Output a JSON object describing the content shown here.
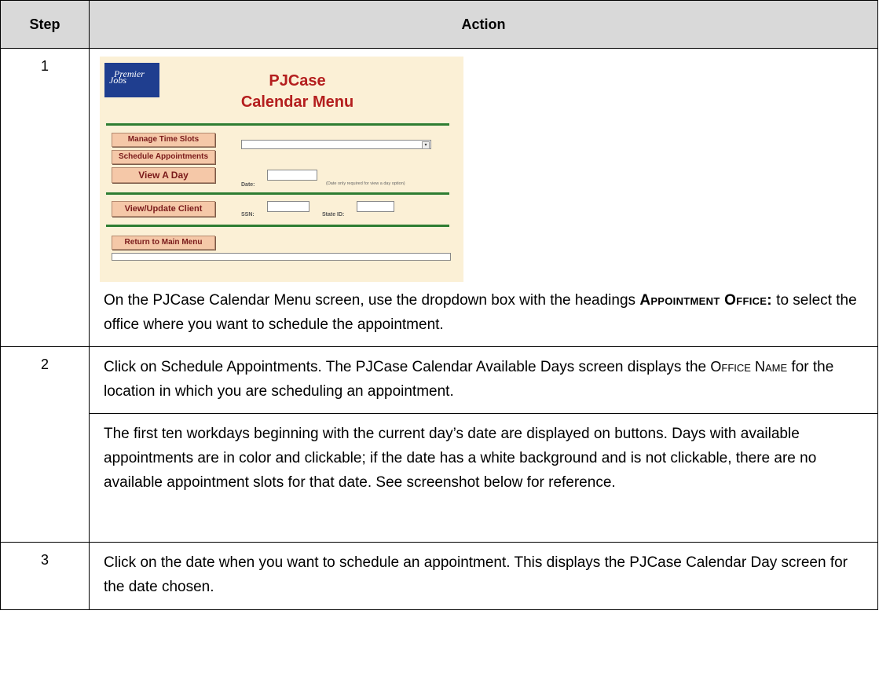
{
  "table": {
    "headers": {
      "step": "Step",
      "action": "Action"
    },
    "rows": [
      {
        "step": "1"
      },
      {
        "step": "2"
      },
      {
        "step": "3"
      }
    ]
  },
  "screenshot": {
    "logo_text_1": "Premier",
    "logo_text_2": "Jobs",
    "title_line1": "PJCase",
    "title_line2": "Calendar Menu",
    "buttons": {
      "manage_time_slots": "Manage Time Slots",
      "schedule_appointments": "Schedule Appointments",
      "view_a_day": "View A Day",
      "view_update_client": "View/Update Client",
      "return_to_main_menu": "Return to Main Menu"
    },
    "labels": {
      "appointment_office": "Appointment Office:",
      "date": "Date:",
      "date_note": "(Date only required for view a day option)",
      "ssn": "SSN:",
      "state_id": "State ID:"
    },
    "dropdown_arrow": "▾"
  },
  "step1": {
    "text_before": "On the PJCase Calendar Menu screen, use the dropdown box with the headings ",
    "bold_heading": "Appointment Office:",
    "text_after": " to select the office where you want to schedule the appointment."
  },
  "step2": {
    "p1_before": "Click on Schedule Appointments. The PJCase Calendar Available Days screen displays the ",
    "p1_smallcaps": "Office Name",
    "p1_after": " for the location in which you are scheduling an appointment.",
    "p2": "The first ten workdays beginning with the current day’s date are displayed on buttons. Days with available appointments are in color and clickable; if the date has a white background and is not clickable, there are no available appointment slots for that date. See screenshot below for reference."
  },
  "step3": {
    "text": "Click on the date when you want to schedule an appointment. This displays the PJCase Calendar Day screen for the date chosen."
  }
}
